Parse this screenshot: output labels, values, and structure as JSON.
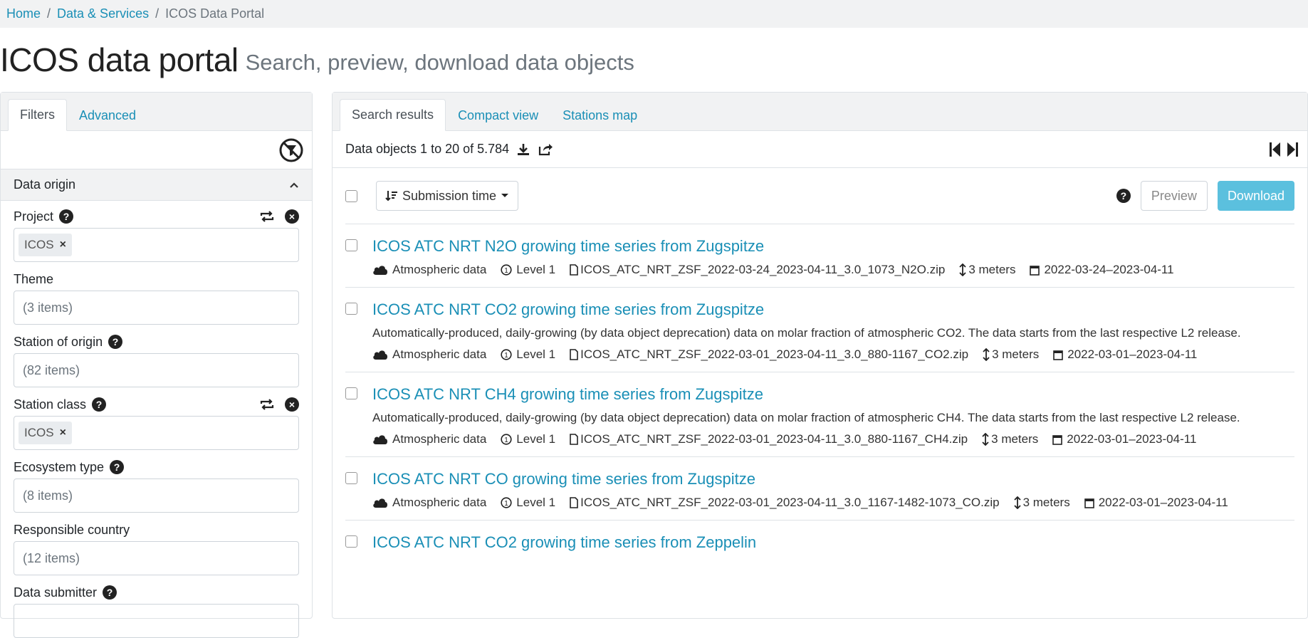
{
  "breadcrumb": [
    "Home",
    "Data & Services",
    "ICOS Data Portal"
  ],
  "page": {
    "title": "ICOS data portal",
    "subtitle": "Search, preview, download data objects"
  },
  "left_tabs": [
    "Filters",
    "Advanced"
  ],
  "data_origin": {
    "heading": "Data origin",
    "filters": [
      {
        "label": "Project",
        "help": true,
        "chip": "ICOS",
        "actions": true
      },
      {
        "label": "Theme",
        "help": false,
        "placeholder": "(3 items)"
      },
      {
        "label": "Station of origin",
        "help": true,
        "placeholder": "(82 items)"
      },
      {
        "label": "Station class",
        "help": true,
        "chip": "ICOS",
        "actions": true
      },
      {
        "label": "Ecosystem type",
        "help": true,
        "placeholder": "(8 items)"
      },
      {
        "label": "Responsible country",
        "help": false,
        "placeholder": "(12 items)"
      },
      {
        "label": "Data submitter",
        "help": true,
        "placeholder": ""
      }
    ]
  },
  "right_tabs": [
    "Search results",
    "Compact view",
    "Stations map"
  ],
  "results_info": "Data objects 1 to 20 of 5.784",
  "toolbar": {
    "sort_label": "Submission time",
    "preview_label": "Preview",
    "download_label": "Download"
  },
  "results": [
    {
      "title": "ICOS ATC NRT N2O growing time series from Zugspitze",
      "description": "",
      "category": "Atmospheric data",
      "level": "Level 1",
      "file": "ICOS_ATC_NRT_ZSF_2022-03-24_2023-04-11_3.0_1073_N2O.zip",
      "height": "3 meters",
      "dates": "2022-03-24–2023-04-11"
    },
    {
      "title": "ICOS ATC NRT CO2 growing time series from Zugspitze",
      "description": "Automatically-produced, daily-growing (by data object deprecation) data on molar fraction of atmospheric CO2. The data starts from the last respective L2 release.",
      "category": "Atmospheric data",
      "level": "Level 1",
      "file": "ICOS_ATC_NRT_ZSF_2022-03-01_2023-04-11_3.0_880-1167_CO2.zip",
      "height": "3 meters",
      "dates": "2022-03-01–2023-04-11"
    },
    {
      "title": "ICOS ATC NRT CH4 growing time series from Zugspitze",
      "description": "Automatically-produced, daily-growing (by data object deprecation) data on molar fraction of atmospheric CH4. The data starts from the last respective L2 release.",
      "category": "Atmospheric data",
      "level": "Level 1",
      "file": "ICOS_ATC_NRT_ZSF_2022-03-01_2023-04-11_3.0_880-1167_CH4.zip",
      "height": "3 meters",
      "dates": "2022-03-01–2023-04-11"
    },
    {
      "title": "ICOS ATC NRT CO growing time series from Zugspitze",
      "description": "",
      "category": "Atmospheric data",
      "level": "Level 1",
      "file": "ICOS_ATC_NRT_ZSF_2022-03-01_2023-04-11_3.0_1167-1482-1073_CO.zip",
      "height": "3 meters",
      "dates": "2022-03-01–2023-04-11"
    },
    {
      "title": "ICOS ATC NRT CO2 growing time series from Zeppelin",
      "description": "",
      "category": "",
      "level": "",
      "file": "",
      "height": "",
      "dates": ""
    }
  ],
  "colors": {
    "link": "#1a8fb6",
    "download_bg": "#5bc0de",
    "breadcrumb_bg": "#f1f2f3"
  }
}
